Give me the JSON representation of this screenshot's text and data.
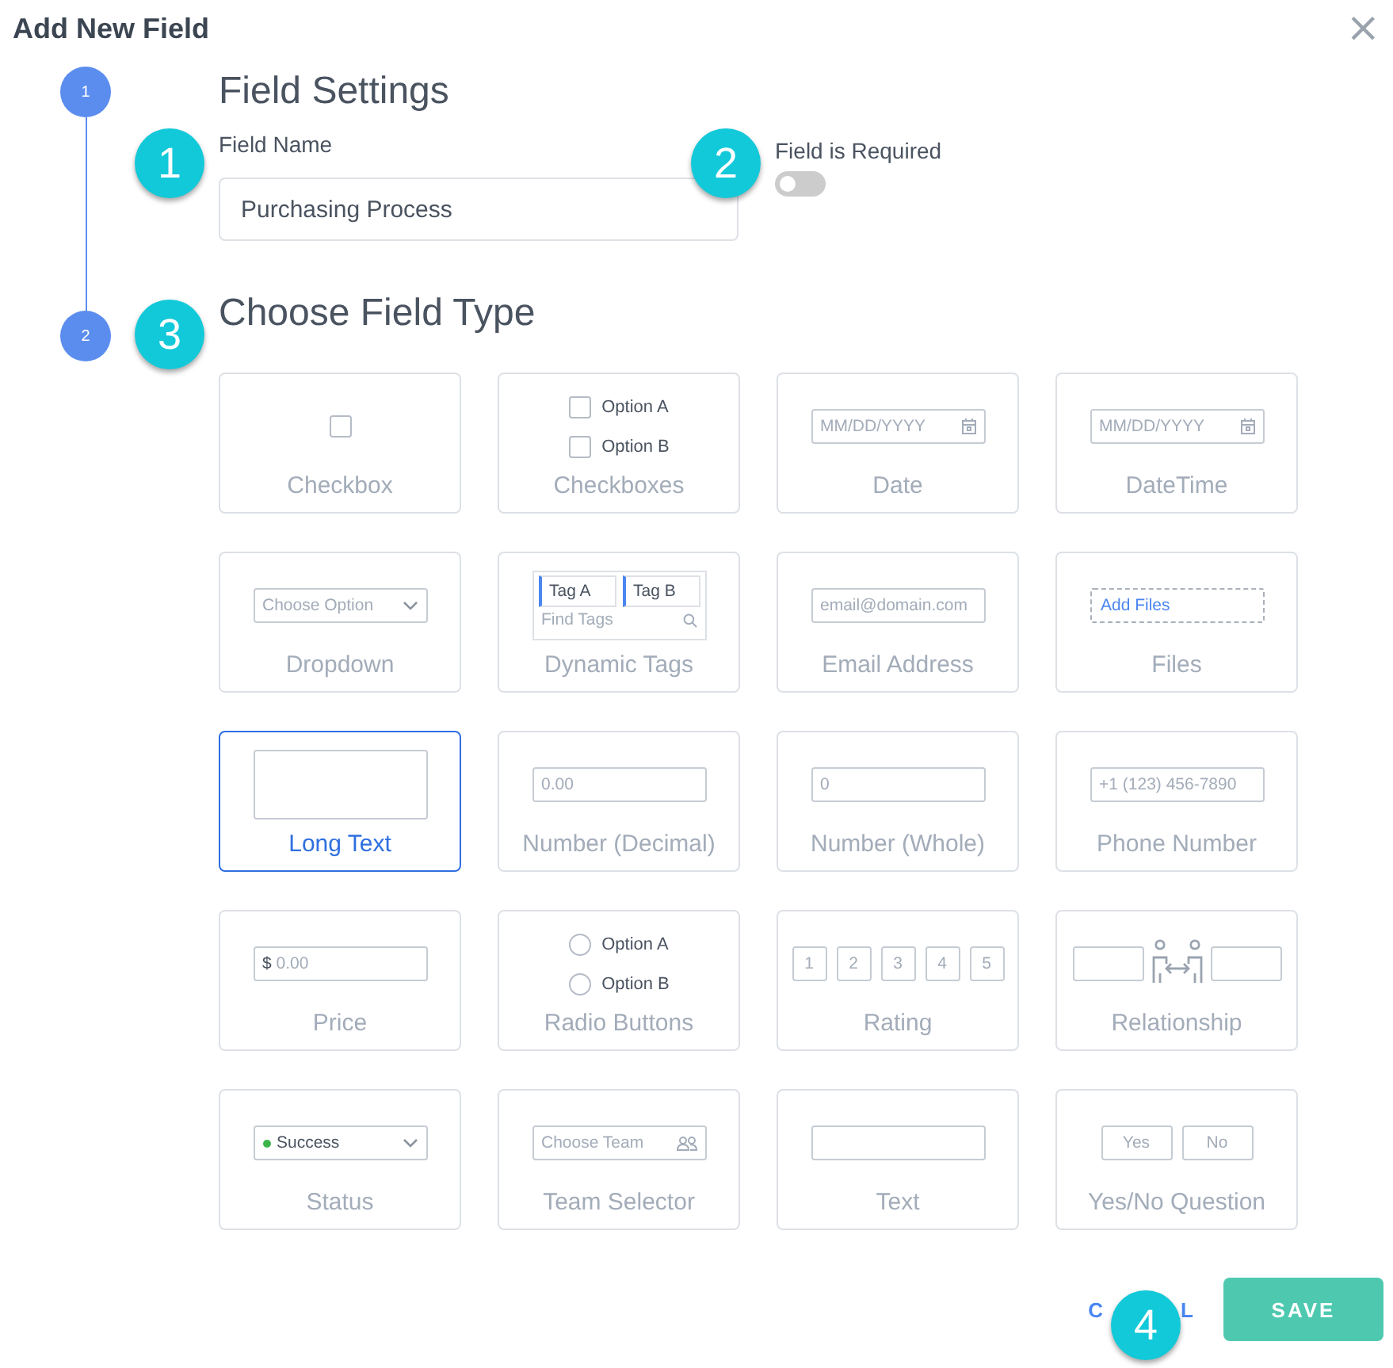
{
  "dialog": {
    "title": "Add New Field",
    "close": "×"
  },
  "steps": [
    {
      "number": "1"
    },
    {
      "number": "2"
    }
  ],
  "callouts": [
    "1",
    "2",
    "3",
    "4"
  ],
  "settings": {
    "heading": "Field Settings",
    "name_label": "Field Name",
    "name_value": "Purchasing Process",
    "required_label": "Field is Required",
    "required_on": false
  },
  "type_heading": "Choose Field Type",
  "field_types": [
    {
      "label": "Checkbox",
      "kind": "checkbox",
      "selected": false
    },
    {
      "label": "Checkboxes",
      "kind": "checkboxes",
      "selected": false,
      "options": [
        "Option A",
        "Option B"
      ]
    },
    {
      "label": "Date",
      "kind": "date",
      "selected": false,
      "placeholder": "MM/DD/YYYY"
    },
    {
      "label": "DateTime",
      "kind": "date",
      "selected": false,
      "placeholder": "MM/DD/YYYY"
    },
    {
      "label": "Dropdown",
      "kind": "select",
      "selected": false,
      "placeholder": "Choose Option"
    },
    {
      "label": "Dynamic Tags",
      "kind": "tags",
      "selected": false,
      "tags": [
        "Tag A",
        "Tag B"
      ],
      "placeholder": "Find Tags"
    },
    {
      "label": "Email Address",
      "kind": "input",
      "selected": false,
      "placeholder": "email@domain.com"
    },
    {
      "label": "Files",
      "kind": "files",
      "selected": false,
      "button": "Add Files"
    },
    {
      "label": "Long Text",
      "kind": "textarea",
      "selected": true
    },
    {
      "label": "Number (Decimal)",
      "kind": "input",
      "selected": false,
      "placeholder": "0.00"
    },
    {
      "label": "Number (Whole)",
      "kind": "input",
      "selected": false,
      "placeholder": "0"
    },
    {
      "label": "Phone Number",
      "kind": "input",
      "selected": false,
      "placeholder": "+1 (123) 456-7890"
    },
    {
      "label": "Price",
      "kind": "price",
      "selected": false,
      "prefix": "$",
      "placeholder": "0.00"
    },
    {
      "label": "Radio Buttons",
      "kind": "radios",
      "selected": false,
      "options": [
        "Option A",
        "Option B"
      ]
    },
    {
      "label": "Rating",
      "kind": "rating",
      "selected": false,
      "items": [
        "1",
        "2",
        "3",
        "4",
        "5"
      ]
    },
    {
      "label": "Relationship",
      "kind": "relationship",
      "selected": false
    },
    {
      "label": "Status",
      "kind": "status",
      "selected": false,
      "value": "Success",
      "color": "#3bb54a"
    },
    {
      "label": "Team Selector",
      "kind": "team",
      "selected": false,
      "placeholder": "Choose Team"
    },
    {
      "label": "Text",
      "kind": "input",
      "selected": false
    },
    {
      "label": "Yes/No Question",
      "kind": "yesno",
      "selected": false,
      "options": [
        "Yes",
        "No"
      ]
    }
  ],
  "footer": {
    "cancel_visible": [
      "C",
      "L"
    ],
    "save": "SAVE"
  }
}
